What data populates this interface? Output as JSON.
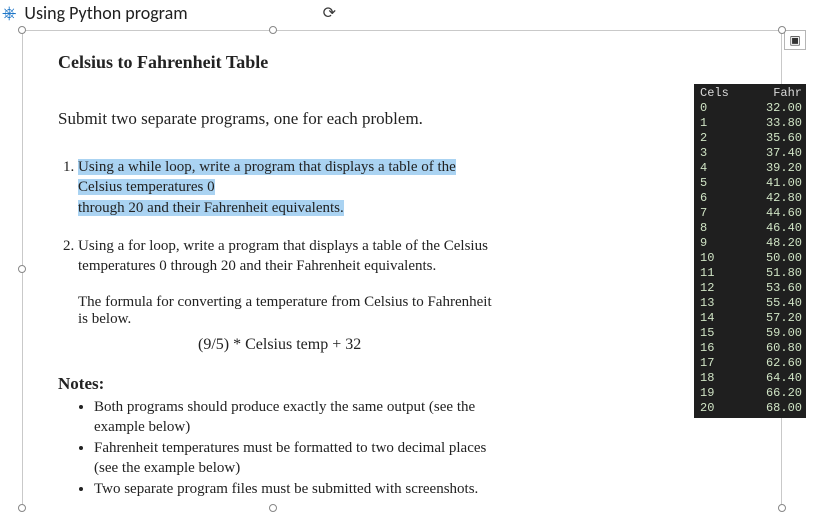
{
  "header": {
    "title": "Using Python program"
  },
  "doc": {
    "title": "Celsius to Fahrenheit Table",
    "subtitle": "Submit two separate programs, one for each problem.",
    "problem1_a": "Using a while loop, write a program that displays a table of the Celsius temperatures 0",
    "problem1_b": "through 20 and their Fahrenheit equivalents.",
    "problem2": "Using a for loop, write a program that displays a table of the Celsius temperatures 0 through 20 and their Fahrenheit equivalents.",
    "formula_intro": "The formula for converting a temperature from Celsius to Fahrenheit is below.",
    "formula": "(9/5) * Celsius temp + 32",
    "notes_head": "Notes:",
    "notes": [
      "Both programs should produce exactly the same output (see the example below)",
      "Fahrenheit temperatures must be formatted to two decimal places (see the example below)",
      "Two separate program files must be submitted with screenshots."
    ]
  },
  "console": {
    "header_cels": "Cels",
    "header_fahr": "Fahr",
    "rows": [
      {
        "c": "0",
        "f": "32.00"
      },
      {
        "c": "1",
        "f": "33.80"
      },
      {
        "c": "2",
        "f": "35.60"
      },
      {
        "c": "3",
        "f": "37.40"
      },
      {
        "c": "4",
        "f": "39.20"
      },
      {
        "c": "5",
        "f": "41.00"
      },
      {
        "c": "6",
        "f": "42.80"
      },
      {
        "c": "7",
        "f": "44.60"
      },
      {
        "c": "8",
        "f": "46.40"
      },
      {
        "c": "9",
        "f": "48.20"
      },
      {
        "c": "10",
        "f": "50.00"
      },
      {
        "c": "11",
        "f": "51.80"
      },
      {
        "c": "12",
        "f": "53.60"
      },
      {
        "c": "13",
        "f": "55.40"
      },
      {
        "c": "14",
        "f": "57.20"
      },
      {
        "c": "15",
        "f": "59.00"
      },
      {
        "c": "16",
        "f": "60.80"
      },
      {
        "c": "17",
        "f": "62.60"
      },
      {
        "c": "18",
        "f": "64.40"
      },
      {
        "c": "19",
        "f": "66.20"
      },
      {
        "c": "20",
        "f": "68.00"
      }
    ]
  }
}
